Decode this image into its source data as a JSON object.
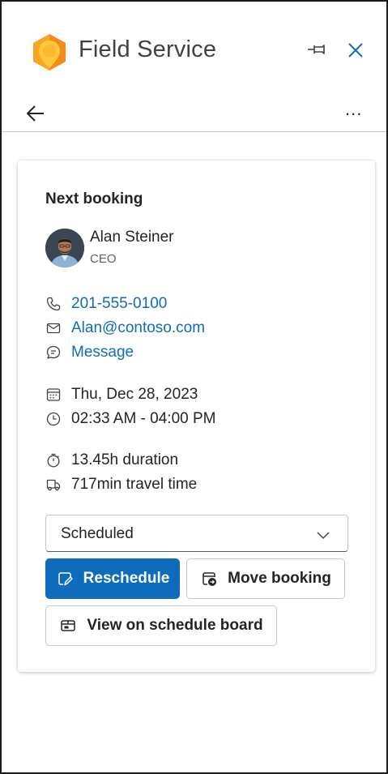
{
  "header": {
    "app_title": "Field Service",
    "more_label": "..."
  },
  "icons": {
    "logo": "field-service-logo",
    "pin": "pin-icon",
    "close": "close-icon",
    "back": "back-arrow-icon"
  },
  "colors": {
    "accent": "#0f6cbd",
    "logo_orange": "#f7a21b",
    "logo_yellow": "#ffc83d"
  },
  "card": {
    "title": "Next booking",
    "contact": {
      "name": "Alan Steiner",
      "role": "CEO"
    },
    "phone": "201-555-0100",
    "email": "Alan@contoso.com",
    "message": "Message",
    "date": "Thu, Dec 28, 2023",
    "time": "02:33 AM - 04:00 PM",
    "duration": "13.45h duration",
    "travel": "717min travel time",
    "status": {
      "selected": "Scheduled"
    },
    "buttons": {
      "reschedule": "Reschedule",
      "move": "Move booking",
      "board": "View on schedule board"
    }
  }
}
